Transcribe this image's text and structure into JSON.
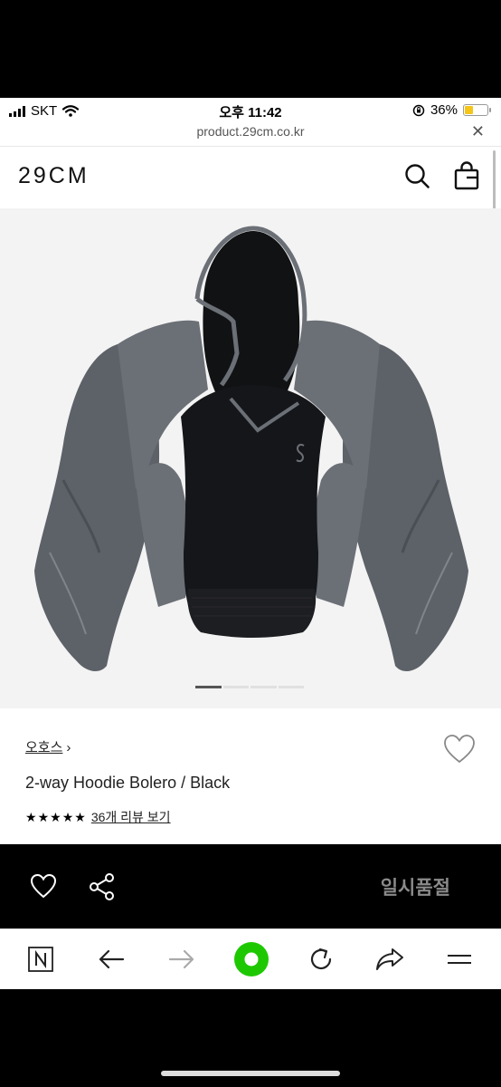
{
  "status_bar": {
    "carrier": "SKT",
    "time": "오후 11:42",
    "battery": "36%",
    "battery_level": 0.36
  },
  "url_bar": {
    "url": "product.29cm.co.kr",
    "close_label": "✕"
  },
  "header": {
    "logo": "29CM",
    "search_icon": "search-icon",
    "bag_icon": "shopping-bag-icon"
  },
  "product": {
    "brand": "오호스",
    "brand_chevron": "›",
    "name": "2-way Hoodie Bolero / Black",
    "rating_stars": 5,
    "review_link": "36개 리뷰 보기",
    "image_count": 4,
    "active_image": 0
  },
  "action_bar": {
    "wish_icon": "heart-icon",
    "share_icon": "share-icon",
    "status_label": "일시품절"
  },
  "browser_toolbar": {
    "items": [
      "naver-icon",
      "back-arrow-icon",
      "forward-arrow-icon",
      "green-circle-icon",
      "reload-icon",
      "share-arrow-icon",
      "menu-icon"
    ]
  },
  "colors": {
    "accent_green": "#1ec800",
    "sold_out_text": "#8a8a8a",
    "battery_fill": "#f5c518"
  }
}
